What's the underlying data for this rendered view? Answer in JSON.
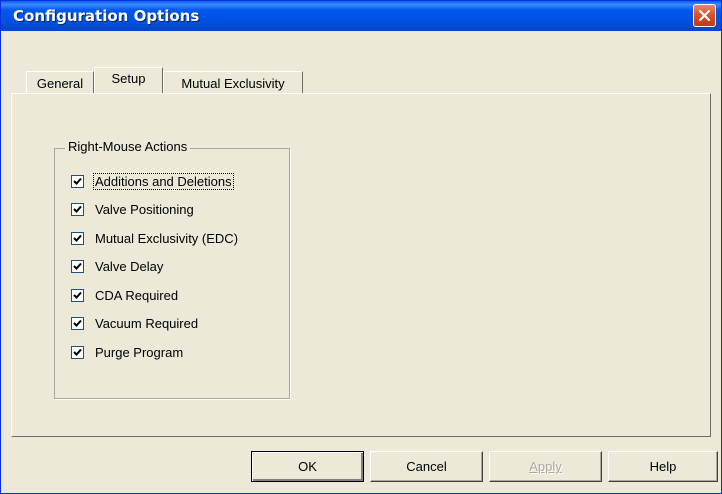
{
  "window": {
    "title": "Configuration Options",
    "close_icon": "close-x-icon"
  },
  "tabs": [
    {
      "label": "General",
      "active": false
    },
    {
      "label": "Setup",
      "active": true
    },
    {
      "label": "Mutual Exclusivity",
      "active": false
    }
  ],
  "group": {
    "legend": "Right-Mouse Actions",
    "items": [
      {
        "label": "Additions and Deletions",
        "checked": true,
        "focused": true
      },
      {
        "label": "Valve Positioning",
        "checked": true
      },
      {
        "label": "Mutual Exclusivity (EDC)",
        "checked": true
      },
      {
        "label": "Valve Delay",
        "checked": true
      },
      {
        "label": "CDA Required",
        "checked": true
      },
      {
        "label": "Vacuum Required",
        "checked": true
      },
      {
        "label": "Purge Program",
        "checked": true
      }
    ]
  },
  "buttons": {
    "ok": "OK",
    "cancel": "Cancel",
    "apply": "Apply",
    "help": "Help"
  },
  "colors": {
    "titlebar": "#0054e3",
    "dialog_bg": "#ece9d8",
    "close_button": "#d8542c"
  }
}
